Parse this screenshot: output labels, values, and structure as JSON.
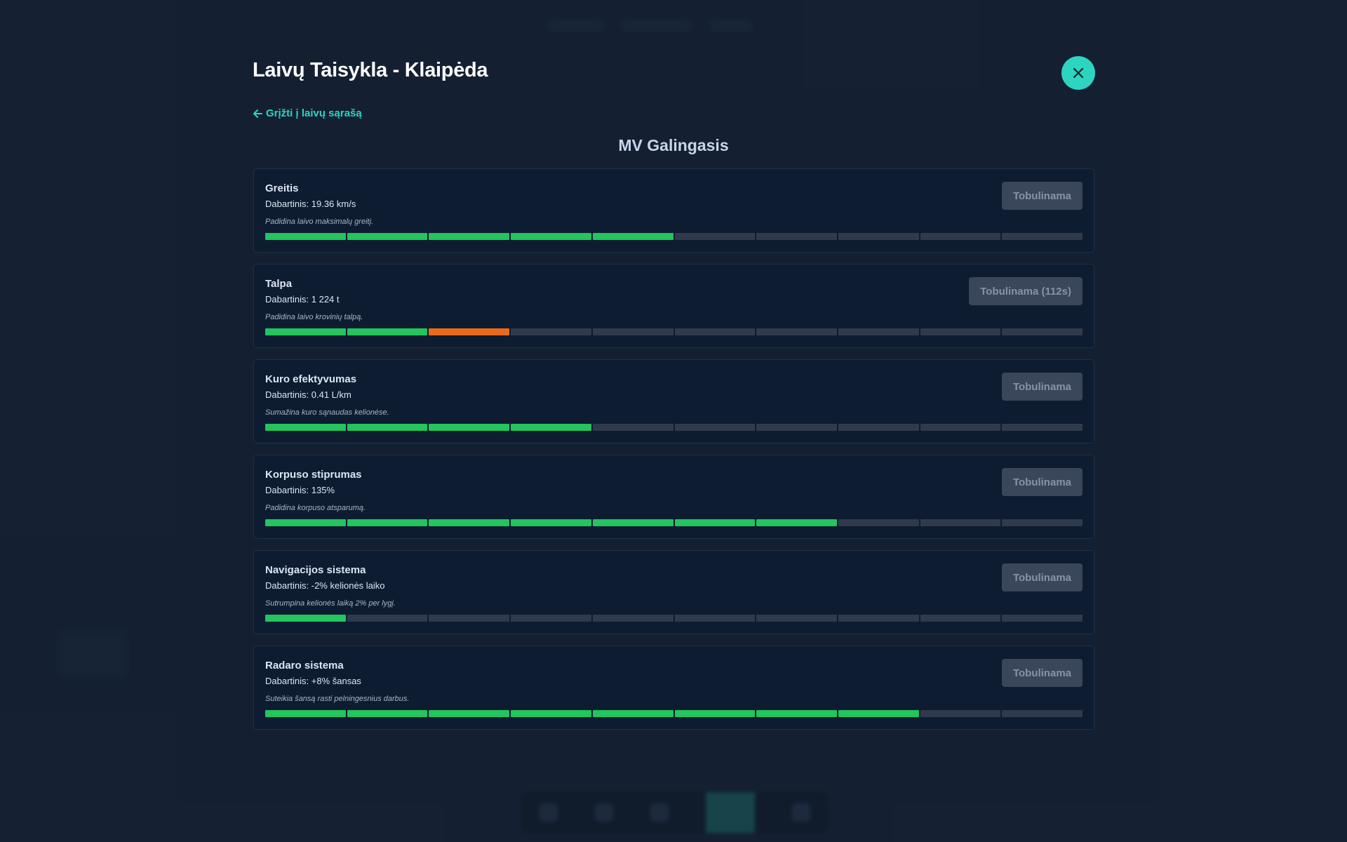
{
  "modal": {
    "title": "Laivų Taisykla - Klaipėda",
    "back_label": "Grįžti į laivų sąrašą",
    "ship_name": "MV Galingasis"
  },
  "colors": {
    "accent": "#2dd4bf",
    "level_done": "#22c55e",
    "level_in_progress": "#ea6a1c",
    "level_empty": "#2f3b4c"
  },
  "upgrades": [
    {
      "name": "Greitis",
      "current": "Dabartinis: 19.36 km/s",
      "description": "Padidina laivo maksimalų greitį.",
      "button_label": "Tobulinama",
      "level": 5,
      "in_progress_level": null,
      "max_level": 10
    },
    {
      "name": "Talpa",
      "current": "Dabartinis: 1 224 t",
      "description": "Padidina laivo krovinių talpą.",
      "button_label": "Tobulinama (112s)",
      "level": 2,
      "in_progress_level": 3,
      "max_level": 10
    },
    {
      "name": "Kuro efektyvumas",
      "current": "Dabartinis: 0.41 L/km",
      "description": "Sumažina kuro sąnaudas kelionėse.",
      "button_label": "Tobulinama",
      "level": 4,
      "in_progress_level": null,
      "max_level": 10
    },
    {
      "name": "Korpuso stiprumas",
      "current": "Dabartinis: 135%",
      "description": "Padidina korpuso atsparumą.",
      "button_label": "Tobulinama",
      "level": 7,
      "in_progress_level": null,
      "max_level": 10
    },
    {
      "name": "Navigacijos sistema",
      "current": "Dabartinis: -2% kelionės laiko",
      "description": "Sutrumpina kelionės laiką 2% per lygį.",
      "button_label": "Tobulinama",
      "level": 1,
      "in_progress_level": null,
      "max_level": 10
    },
    {
      "name": "Radaro sistema",
      "current": "Dabartinis: +8% šansas",
      "description": "Suteikia šansą rasti pelningesnius darbus.",
      "button_label": "Tobulinama",
      "level": 8,
      "in_progress_level": null,
      "max_level": 10
    }
  ]
}
